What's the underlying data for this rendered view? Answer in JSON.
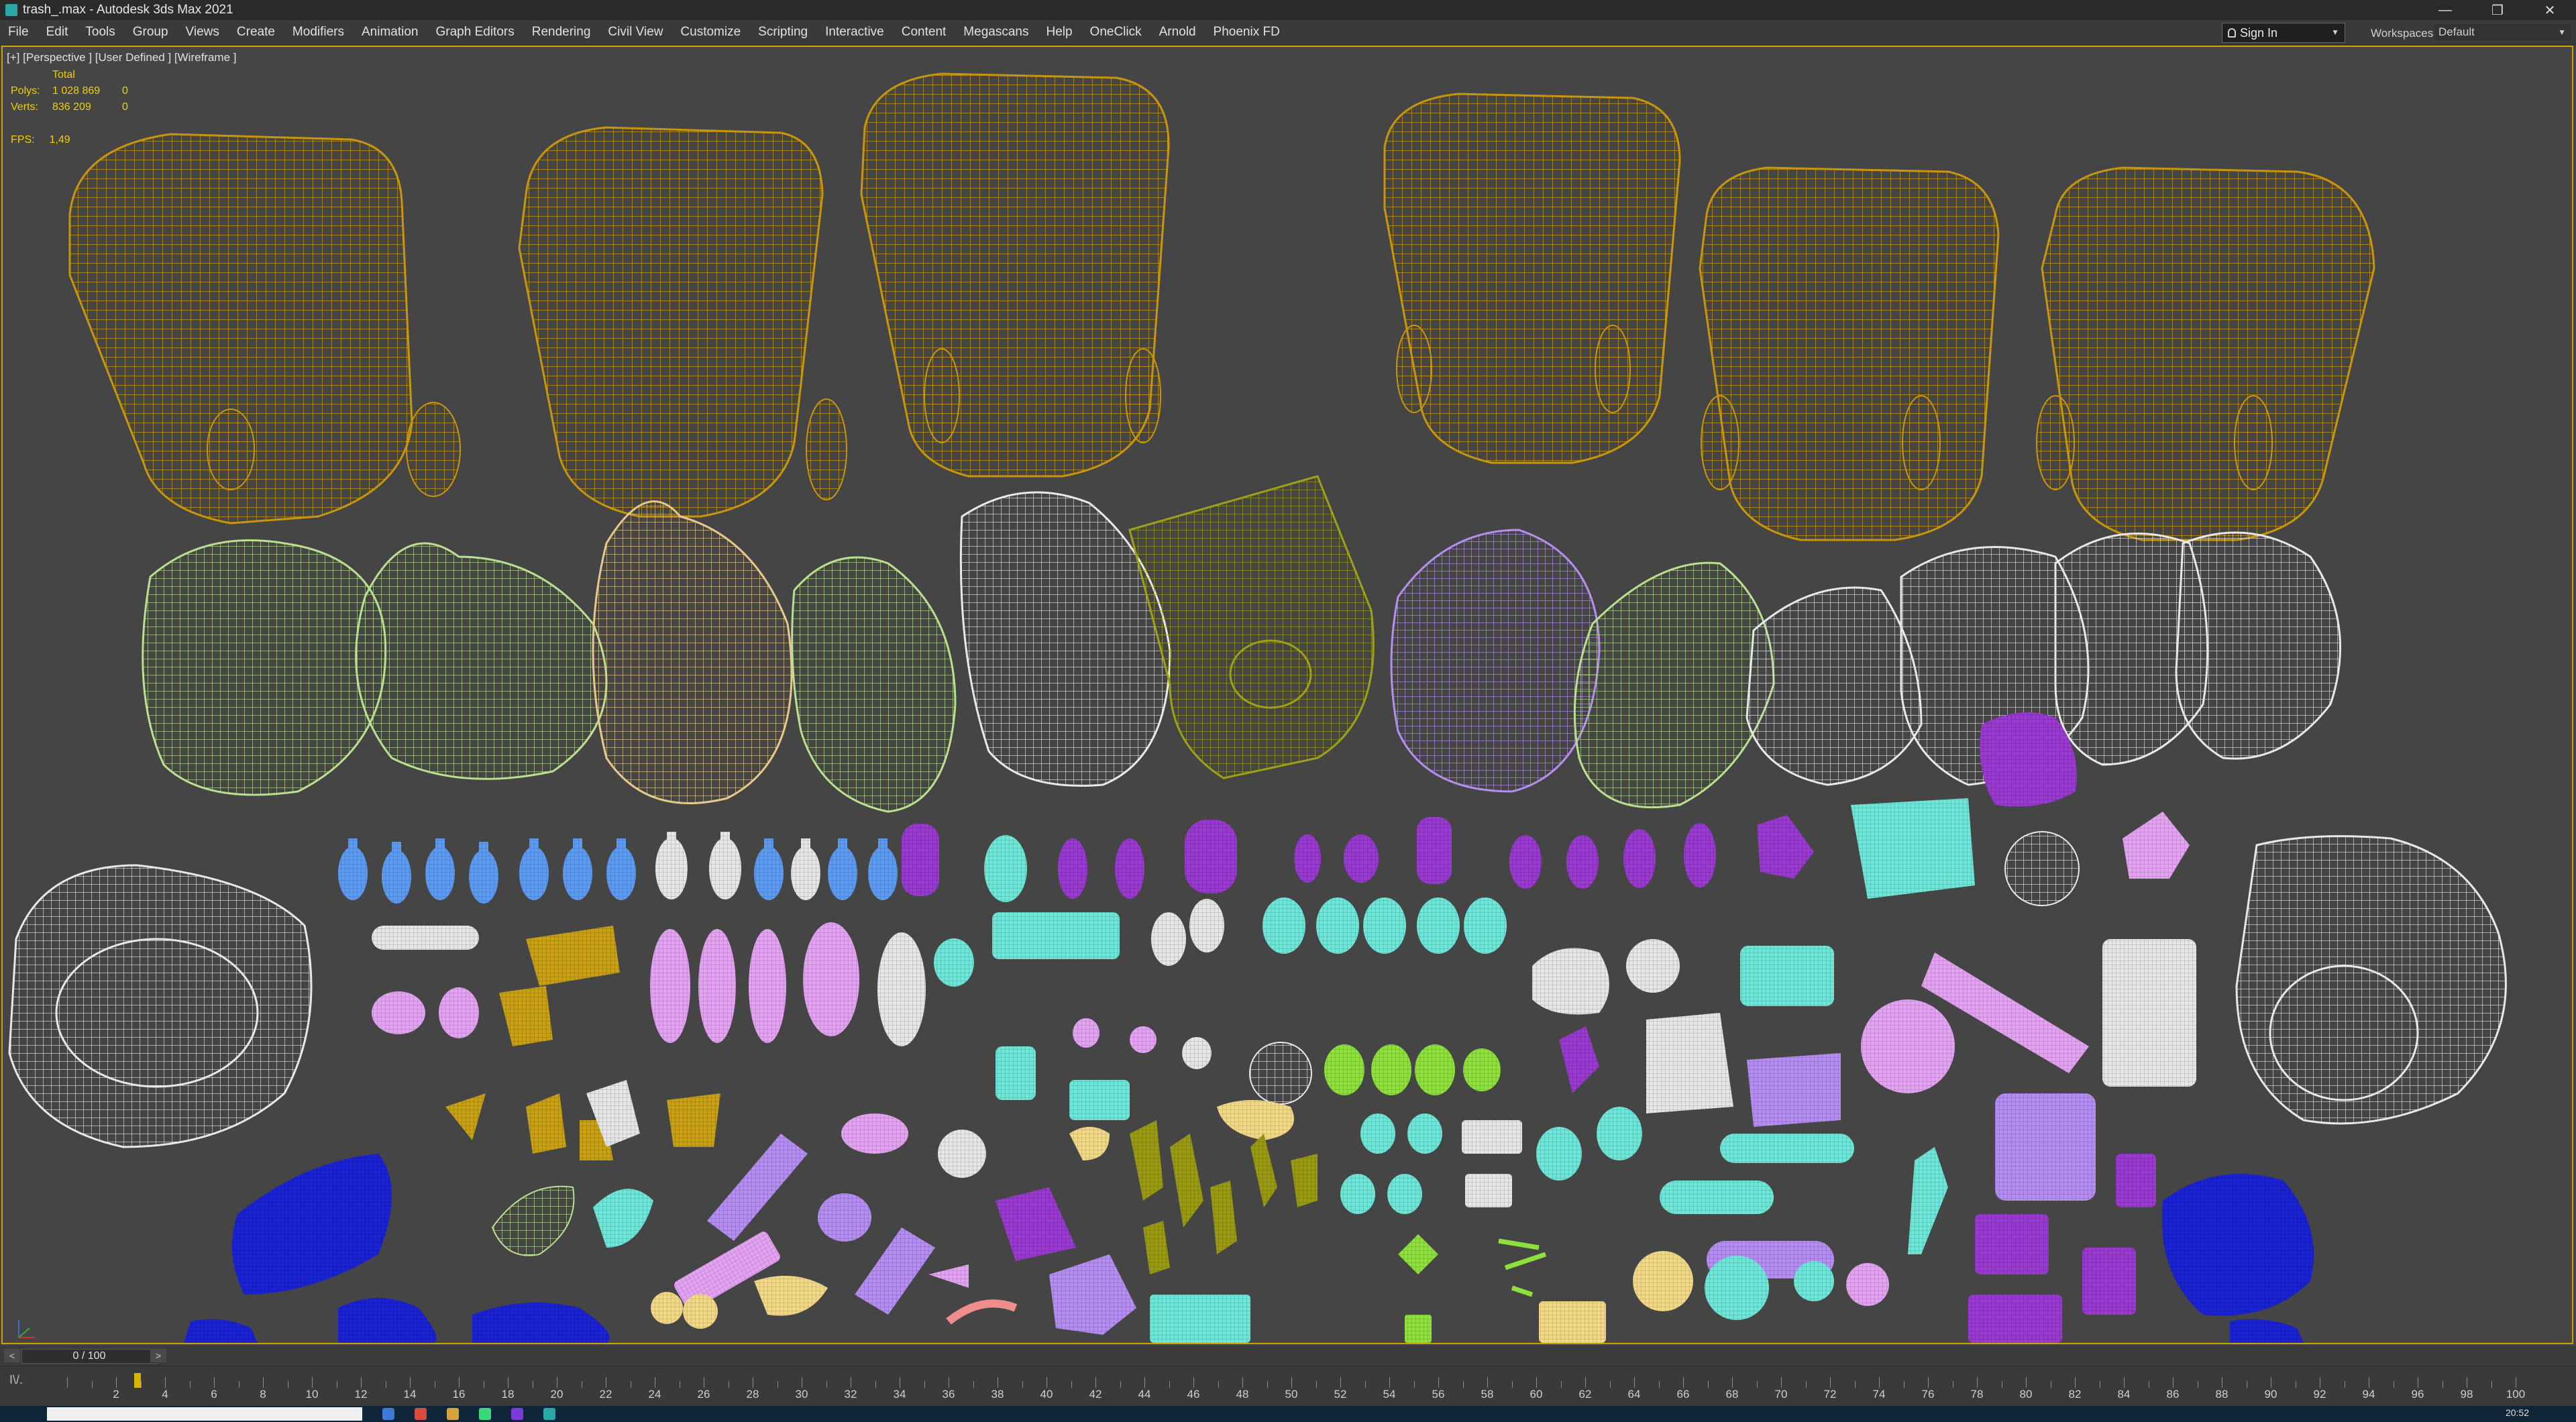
{
  "window": {
    "title": "trash_.max - Autodesk 3ds Max 2021"
  },
  "window_controls": {
    "minimize": "—",
    "restore": "❐",
    "close": "✕"
  },
  "menu": [
    "File",
    "Edit",
    "Tools",
    "Group",
    "Views",
    "Create",
    "Modifiers",
    "Animation",
    "Graph Editors",
    "Rendering",
    "Civil View",
    "Customize",
    "Scripting",
    "Interactive",
    "Content",
    "Megascans",
    "Help",
    "OneClick",
    "Arnold",
    "Phoenix FD"
  ],
  "account": {
    "signin_label": "Sign In"
  },
  "workspaces": {
    "label": "Workspaces:",
    "value": "Default"
  },
  "viewport": {
    "label": "[+] [Perspective ] [User Defined ] [Wireframe ]",
    "stats": {
      "header": "Total",
      "polys_label": "Polys:",
      "polys_value": "1 028 869",
      "polys_sel": "0",
      "verts_label": "Verts:",
      "verts_value": "836 209",
      "verts_sel": "0",
      "fps_label": "FPS:",
      "fps_value": "1,49"
    },
    "colors": {
      "bins": "#c8960c",
      "bags_green": "#b9e08f",
      "bag_tan": "#e6c98a",
      "white": "#e8e8e8",
      "olive": "#a0a018",
      "purple": "#b58ef0",
      "blue_bottles": "#5c9cf0",
      "cyan": "#6fe6d8",
      "pink": "#e3a3f0",
      "violet": "#9a3ad0",
      "dark_blue": "#1a22d8",
      "yellow_small": "#f0d888",
      "bright_green": "#8ee03a"
    }
  },
  "timeline": {
    "frame_display": "0 / 100",
    "prev": "<",
    "next": ">",
    "range": [
      0,
      100
    ],
    "track_label": "I\\/."
  },
  "taskbar": {
    "clock": "20:52"
  }
}
